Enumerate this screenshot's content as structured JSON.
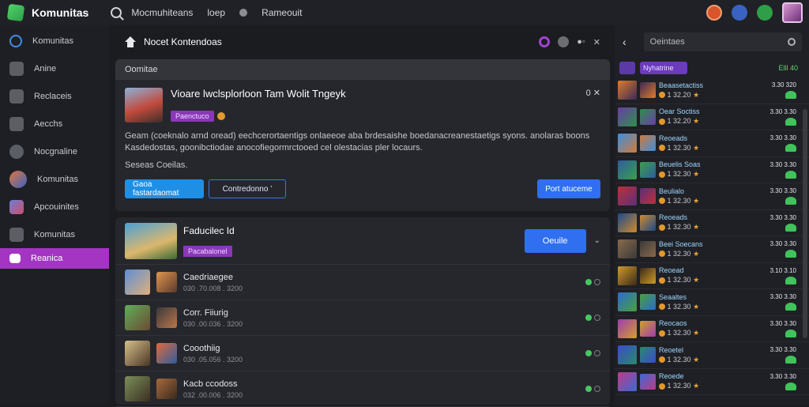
{
  "topbar": {
    "brand": "Komunitas",
    "nav": [
      "Mocmuhiteans",
      "loep",
      "Rameouit"
    ]
  },
  "sidebar": {
    "items": [
      {
        "label": "Komunitas",
        "icon": "search-icon"
      },
      {
        "label": "Anine",
        "icon": "chart-icon"
      },
      {
        "label": "Reclaceis",
        "icon": "bag-icon"
      },
      {
        "label": "Aecchs",
        "icon": "rocket-icon"
      },
      {
        "label": "Nocgnaline",
        "icon": "controller-icon"
      },
      {
        "label": "Komunitas",
        "icon": "avatar-icon"
      },
      {
        "label": "Apcouinites",
        "icon": "profile-icon"
      },
      {
        "label": "Komunitas",
        "icon": "gift-icon"
      },
      {
        "label": "Reanica",
        "icon": "game-icon"
      }
    ],
    "active_index": 8
  },
  "main": {
    "title": "Nocet Kontendoas",
    "head_icons": [
      "notification-icon",
      "info-icon",
      "users-icon",
      "close-icon"
    ],
    "card1": {
      "tab": "Oomitae",
      "post_title": "Vioare lwclsplorloon Tam Wolit Tngeyk",
      "tag": "Paenctuco",
      "close_label": "0 ✕",
      "body": "Geam (coeknalo arnd oread) eechcerortaentigs onlaeeoe aba brdesaishe boedanacreanestaetigs syons. anolaras boons Kasdedostas, goonibctiodae anocofiegormrctooed cel olestacias pler locaurs.",
      "link": "Seseas Coeilas.",
      "btn_primary": "Gaoa fastardaomat",
      "btn_outline": "Contredonno ’",
      "btn_right": "Port atuceme"
    },
    "card2": {
      "title": "Faducilec Id",
      "tag": "Pacabalonel",
      "join": "Oeuile",
      "members": [
        {
          "name": "Caedriaegee",
          "sub": "030 .70.008 . 3200"
        },
        {
          "name": "Corr. Fiiurig",
          "sub": "030 .00.036 . 3200"
        },
        {
          "name": "Cooothiig",
          "sub": "030 .05.056 . 3200"
        },
        {
          "name": "Kacb ccodoss",
          "sub": "032 .00.006 . 3200"
        }
      ]
    }
  },
  "right": {
    "search_placeholder": "Oeintaes",
    "chip_label": "Nyhatrine",
    "count": "Elll 40",
    "rows": [
      {
        "name": "Beaasetactiss",
        "meta": "1 32.20",
        "score": "3.30 320"
      },
      {
        "name": "Oear Soctiss",
        "meta": "1 32.20",
        "score": "3.30 3.30"
      },
      {
        "name": "Reoeads",
        "meta": "1 32.30",
        "score": "3.30 3.30"
      },
      {
        "name": "Beuelis Soas",
        "meta": "1 32.30",
        "score": "3.30 3.30"
      },
      {
        "name": "Beulialo",
        "meta": "1 32.30",
        "score": "3.30 3.30"
      },
      {
        "name": "Reoeads",
        "meta": "1 32.30",
        "score": "3.30 3.30"
      },
      {
        "name": "Beei Soecans",
        "meta": "1 32.30",
        "score": "3.30 3.30"
      },
      {
        "name": "Reoead",
        "meta": "1 32.30",
        "score": "3.10 3.10"
      },
      {
        "name": "Seaaltes",
        "meta": "1 32.30",
        "score": "3.30 3.30"
      },
      {
        "name": "Reocaos",
        "meta": "1 32.30",
        "score": "3.30 3.30"
      },
      {
        "name": "Reoetel",
        "meta": "1 32.30",
        "score": "3.30 3.30"
      },
      {
        "name": "Reoede",
        "meta": "1 32.30",
        "score": "3.30 3.30"
      }
    ]
  },
  "colors": {
    "accent_purple": "#a335c2",
    "primary_blue": "#2f6ff0",
    "online_green": "#45c85f"
  }
}
